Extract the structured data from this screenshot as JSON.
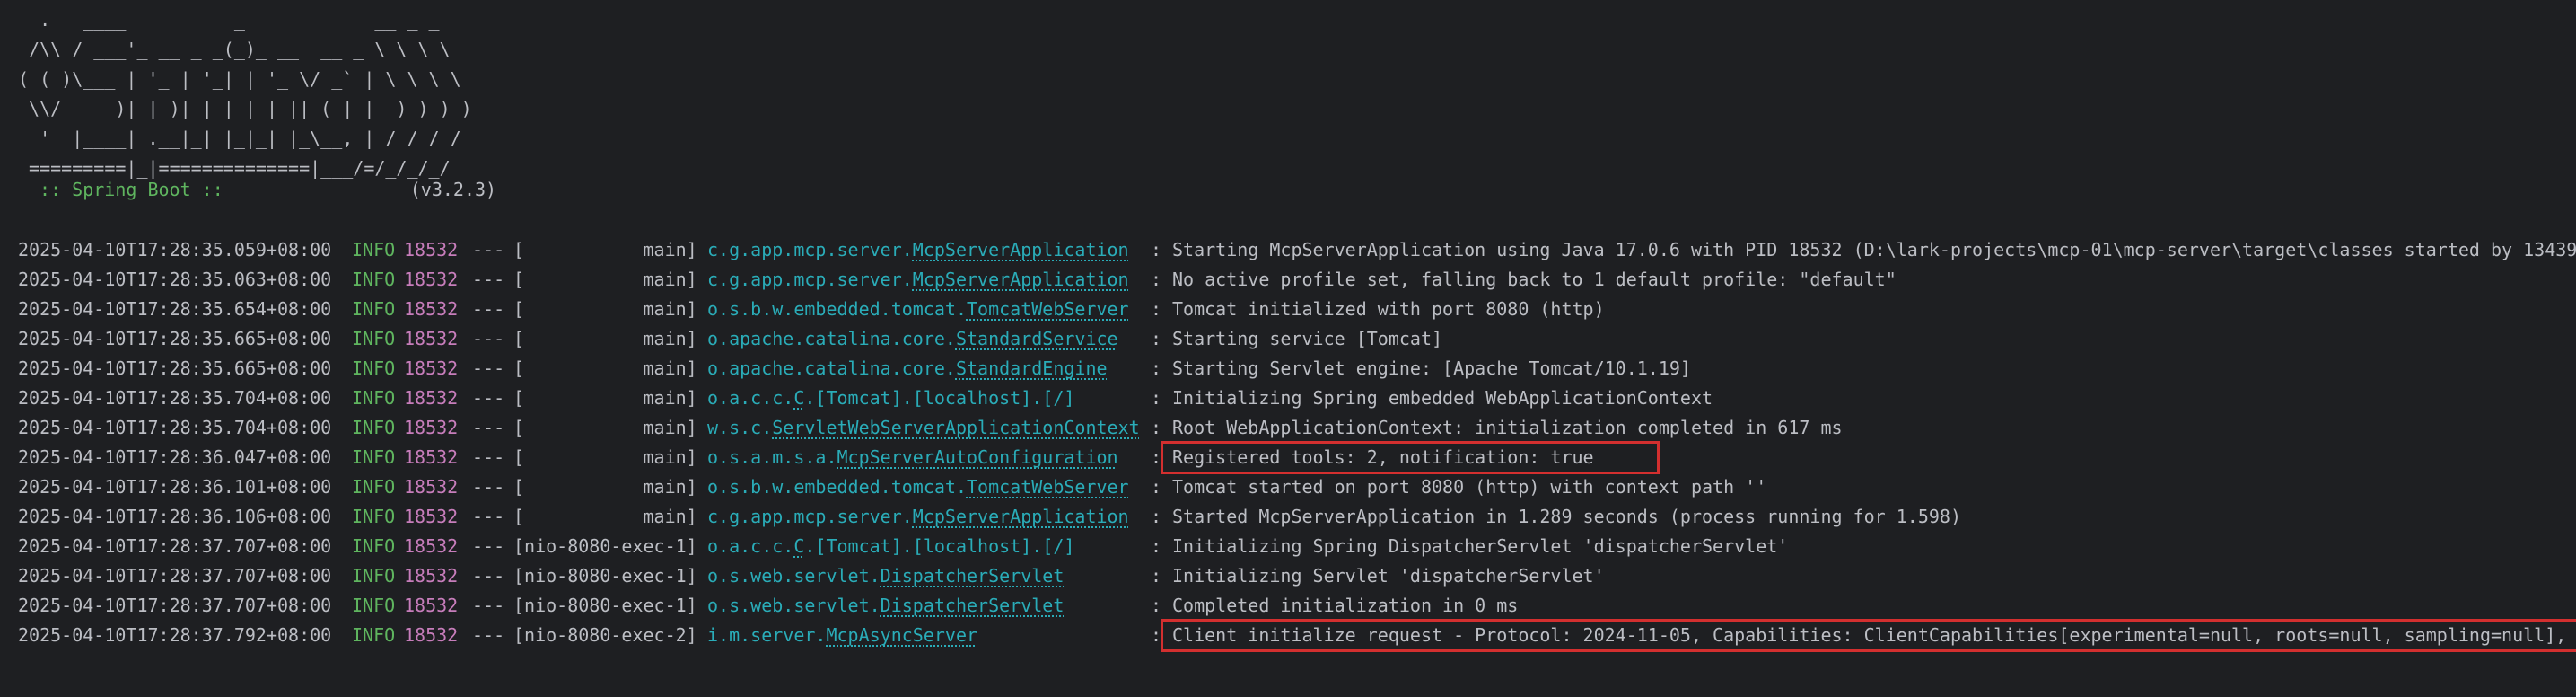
{
  "banner": {
    "ascii_art": "  .   ____          _            __ _ _\n /\\\\ / ___'_ __ _ _(_)_ __  __ _ \\ \\ \\ \\\n( ( )\\___ | '_ | '_| | '_ \\/ _` | \\ \\ \\ \\\n \\\\/  ___)| |_)| | | | | || (_| |  ) ) ) )\n  '  |____| .__|_| |_|_| |_\\__, | / / / /\n =========|_|==============|___/=/_/_/_/",
    "boot_label": " :: Spring Boot ::",
    "boot_version": "(v3.2.3)"
  },
  "log_rows": [
    {
      "timestamp": "2025-04-10T17:28:35.059+08:00",
      "level": "INFO",
      "pid": "18532",
      "sep": "---",
      "thread": "[           main]",
      "logger_prefix": "c.g.app.mcp.server.",
      "logger_class": "McpServerApplication",
      "message": "Starting McpServerApplication using Java 17.0.6 with PID 18532 (D:\\lark-projects\\mcp-01\\mcp-server\\target\\classes started by 13439"
    },
    {
      "timestamp": "2025-04-10T17:28:35.063+08:00",
      "level": "INFO",
      "pid": "18532",
      "sep": "---",
      "thread": "[           main]",
      "logger_prefix": "c.g.app.mcp.server.",
      "logger_class": "McpServerApplication",
      "message": "No active profile set, falling back to 1 default profile: \"default\""
    },
    {
      "timestamp": "2025-04-10T17:28:35.654+08:00",
      "level": "INFO",
      "pid": "18532",
      "sep": "---",
      "thread": "[           main]",
      "logger_prefix": "o.s.b.w.embedded.tomcat.",
      "logger_class": "TomcatWebServer",
      "message": "Tomcat initialized with port 8080 (http)"
    },
    {
      "timestamp": "2025-04-10T17:28:35.665+08:00",
      "level": "INFO",
      "pid": "18532",
      "sep": "---",
      "thread": "[           main]",
      "logger_prefix": "o.apache.catalina.core.",
      "logger_class": "StandardService",
      "message": "Starting service [Tomcat]"
    },
    {
      "timestamp": "2025-04-10T17:28:35.665+08:00",
      "level": "INFO",
      "pid": "18532",
      "sep": "---",
      "thread": "[           main]",
      "logger_prefix": "o.apache.catalina.core.",
      "logger_class": "StandardEngine",
      "message": "Starting Servlet engine: [Apache Tomcat/10.1.19]"
    },
    {
      "timestamp": "2025-04-10T17:28:35.704+08:00",
      "level": "INFO",
      "pid": "18532",
      "sep": "---",
      "thread": "[           main]",
      "logger_prefix": "o.a.c.c.",
      "logger_class": "C",
      "logger_suffix": ".[Tomcat].[localhost].[/]",
      "message": "Initializing Spring embedded WebApplicationContext"
    },
    {
      "timestamp": "2025-04-10T17:28:35.704+08:00",
      "level": "INFO",
      "pid": "18532",
      "sep": "---",
      "thread": "[           main]",
      "logger_prefix": "w.s.c.",
      "logger_class": "ServletWebServerApplicationContext",
      "message": "Root WebApplicationContext: initialization completed in 617 ms"
    },
    {
      "timestamp": "2025-04-10T17:28:36.047+08:00",
      "level": "INFO",
      "pid": "18532",
      "sep": "---",
      "thread": "[           main]",
      "logger_prefix": "o.s.a.m.s.a.",
      "logger_class": "McpServerAutoConfiguration",
      "message": "Registered tools: 2, notification: true",
      "highlight": true
    },
    {
      "timestamp": "2025-04-10T17:28:36.101+08:00",
      "level": "INFO",
      "pid": "18532",
      "sep": "---",
      "thread": "[           main]",
      "logger_prefix": "o.s.b.w.embedded.tomcat.",
      "logger_class": "TomcatWebServer",
      "message": "Tomcat started on port 8080 (http) with context path ''"
    },
    {
      "timestamp": "2025-04-10T17:28:36.106+08:00",
      "level": "INFO",
      "pid": "18532",
      "sep": "---",
      "thread": "[           main]",
      "logger_prefix": "c.g.app.mcp.server.",
      "logger_class": "McpServerApplication",
      "message": "Started McpServerApplication in 1.289 seconds (process running for 1.598)"
    },
    {
      "timestamp": "2025-04-10T17:28:37.707+08:00",
      "level": "INFO",
      "pid": "18532",
      "sep": "---",
      "thread": "[nio-8080-exec-1]",
      "logger_prefix": "o.a.c.c.",
      "logger_class": "C",
      "logger_suffix": ".[Tomcat].[localhost].[/]",
      "message": "Initializing Spring DispatcherServlet 'dispatcherServlet'"
    },
    {
      "timestamp": "2025-04-10T17:28:37.707+08:00",
      "level": "INFO",
      "pid": "18532",
      "sep": "---",
      "thread": "[nio-8080-exec-1]",
      "logger_prefix": "o.s.web.servlet.",
      "logger_class": "DispatcherServlet",
      "message": "Initializing Servlet 'dispatcherServlet'"
    },
    {
      "timestamp": "2025-04-10T17:28:37.707+08:00",
      "level": "INFO",
      "pid": "18532",
      "sep": "---",
      "thread": "[nio-8080-exec-1]",
      "logger_prefix": "o.s.web.servlet.",
      "logger_class": "DispatcherServlet",
      "message": "Completed initialization in 0 ms"
    },
    {
      "timestamp": "2025-04-10T17:28:37.792+08:00",
      "level": "INFO",
      "pid": "18532",
      "sep": "---",
      "thread": "[nio-8080-exec-2]",
      "logger_prefix": "i.m.server.",
      "logger_class": "McpAsyncServer",
      "message": "Client initialize request - Protocol: 2024-11-05, Capabilities: ClientCapabilities[experimental=null, roots=null, sampling=null], :",
      "highlight": true
    }
  ],
  "colors": {
    "background": "#1e1f22",
    "text": "#bcbec4",
    "level_info": "#5fb55f",
    "pid": "#c77dbb",
    "logger": "#2aacb8",
    "highlight_border": "#d32f2f"
  }
}
